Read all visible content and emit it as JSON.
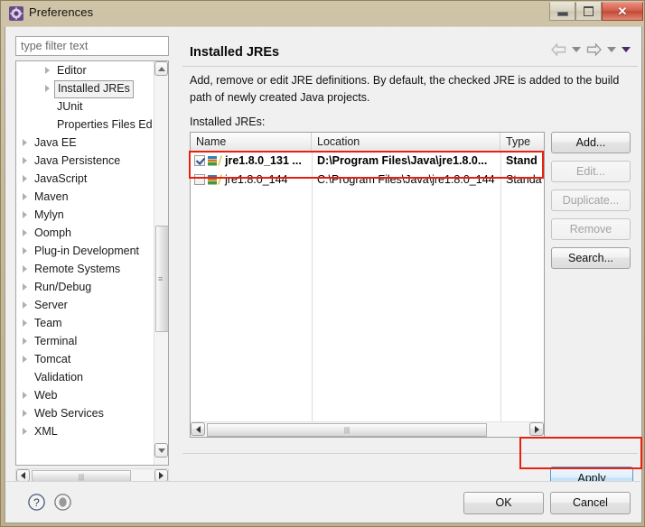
{
  "window": {
    "title": "Preferences",
    "icon": "preferences-gear-icon",
    "controls": {
      "minimize": "minimize-button",
      "maximize": "maximize-button",
      "close": "✕"
    }
  },
  "sidebar": {
    "filter": {
      "placeholder": "type filter text",
      "value": ""
    },
    "items": [
      {
        "label": "Editor",
        "depth": 1,
        "expandable": true,
        "selected": false
      },
      {
        "label": "Installed JREs",
        "depth": 1,
        "expandable": true,
        "selected": true
      },
      {
        "label": "JUnit",
        "depth": 1,
        "expandable": false,
        "selected": false
      },
      {
        "label": "Properties Files Ed",
        "depth": 1,
        "expandable": false,
        "selected": false
      },
      {
        "label": "Java EE",
        "depth": 0,
        "expandable": true,
        "selected": false
      },
      {
        "label": "Java Persistence",
        "depth": 0,
        "expandable": true,
        "selected": false
      },
      {
        "label": "JavaScript",
        "depth": 0,
        "expandable": true,
        "selected": false
      },
      {
        "label": "Maven",
        "depth": 0,
        "expandable": true,
        "selected": false
      },
      {
        "label": "Mylyn",
        "depth": 0,
        "expandable": true,
        "selected": false
      },
      {
        "label": "Oomph",
        "depth": 0,
        "expandable": true,
        "selected": false
      },
      {
        "label": "Plug-in Development",
        "depth": 0,
        "expandable": true,
        "selected": false
      },
      {
        "label": "Remote Systems",
        "depth": 0,
        "expandable": true,
        "selected": false
      },
      {
        "label": "Run/Debug",
        "depth": 0,
        "expandable": true,
        "selected": false
      },
      {
        "label": "Server",
        "depth": 0,
        "expandable": true,
        "selected": false
      },
      {
        "label": "Team",
        "depth": 0,
        "expandable": true,
        "selected": false
      },
      {
        "label": "Terminal",
        "depth": 0,
        "expandable": true,
        "selected": false
      },
      {
        "label": "Tomcat",
        "depth": 0,
        "expandable": true,
        "selected": false
      },
      {
        "label": "Validation",
        "depth": 0,
        "expandable": false,
        "selected": false
      },
      {
        "label": "Web",
        "depth": 0,
        "expandable": true,
        "selected": false
      },
      {
        "label": "Web Services",
        "depth": 0,
        "expandable": true,
        "selected": false
      },
      {
        "label": "XML",
        "depth": 0,
        "expandable": true,
        "selected": false
      }
    ]
  },
  "content": {
    "title": "Installed JREs",
    "description": "Add, remove or edit JRE definitions. By default, the checked JRE is added to the build path of newly created Java projects.",
    "list_label": "Installed JREs:",
    "nav": {
      "back": "back-arrow",
      "back_menu": "back-dropdown",
      "forward": "forward-arrow",
      "forward_menu": "forward-dropdown",
      "view_menu": "view-menu-dropdown"
    }
  },
  "table": {
    "columns": [
      "Name",
      "Location",
      "Type"
    ],
    "rows": [
      {
        "checked": true,
        "bold": true,
        "name": "jre1.8.0_131 ...",
        "location": "D:\\Program Files\\Java\\jre1.8.0...",
        "type": "Stand"
      },
      {
        "checked": false,
        "bold": false,
        "name": "jre1.8.0_144",
        "location": "C:\\Program Files\\Java\\jre1.8.0_144",
        "type": "Standa"
      }
    ]
  },
  "side_buttons": [
    {
      "label": "Add...",
      "enabled": true
    },
    {
      "label": "Edit...",
      "enabled": false
    },
    {
      "label": "Duplicate...",
      "enabled": false
    },
    {
      "label": "Remove",
      "enabled": false
    },
    {
      "label": "Search...",
      "enabled": true
    }
  ],
  "footer": {
    "apply": "Apply",
    "ok": "OK",
    "cancel": "Cancel",
    "help_icon": "help-question-icon",
    "pin_icon": "pin-icon"
  },
  "annotations": {
    "accent_color": "#e8200f",
    "highlighted_row": "jre1.8.0_131 ...",
    "highlighted_button": "Apply"
  }
}
